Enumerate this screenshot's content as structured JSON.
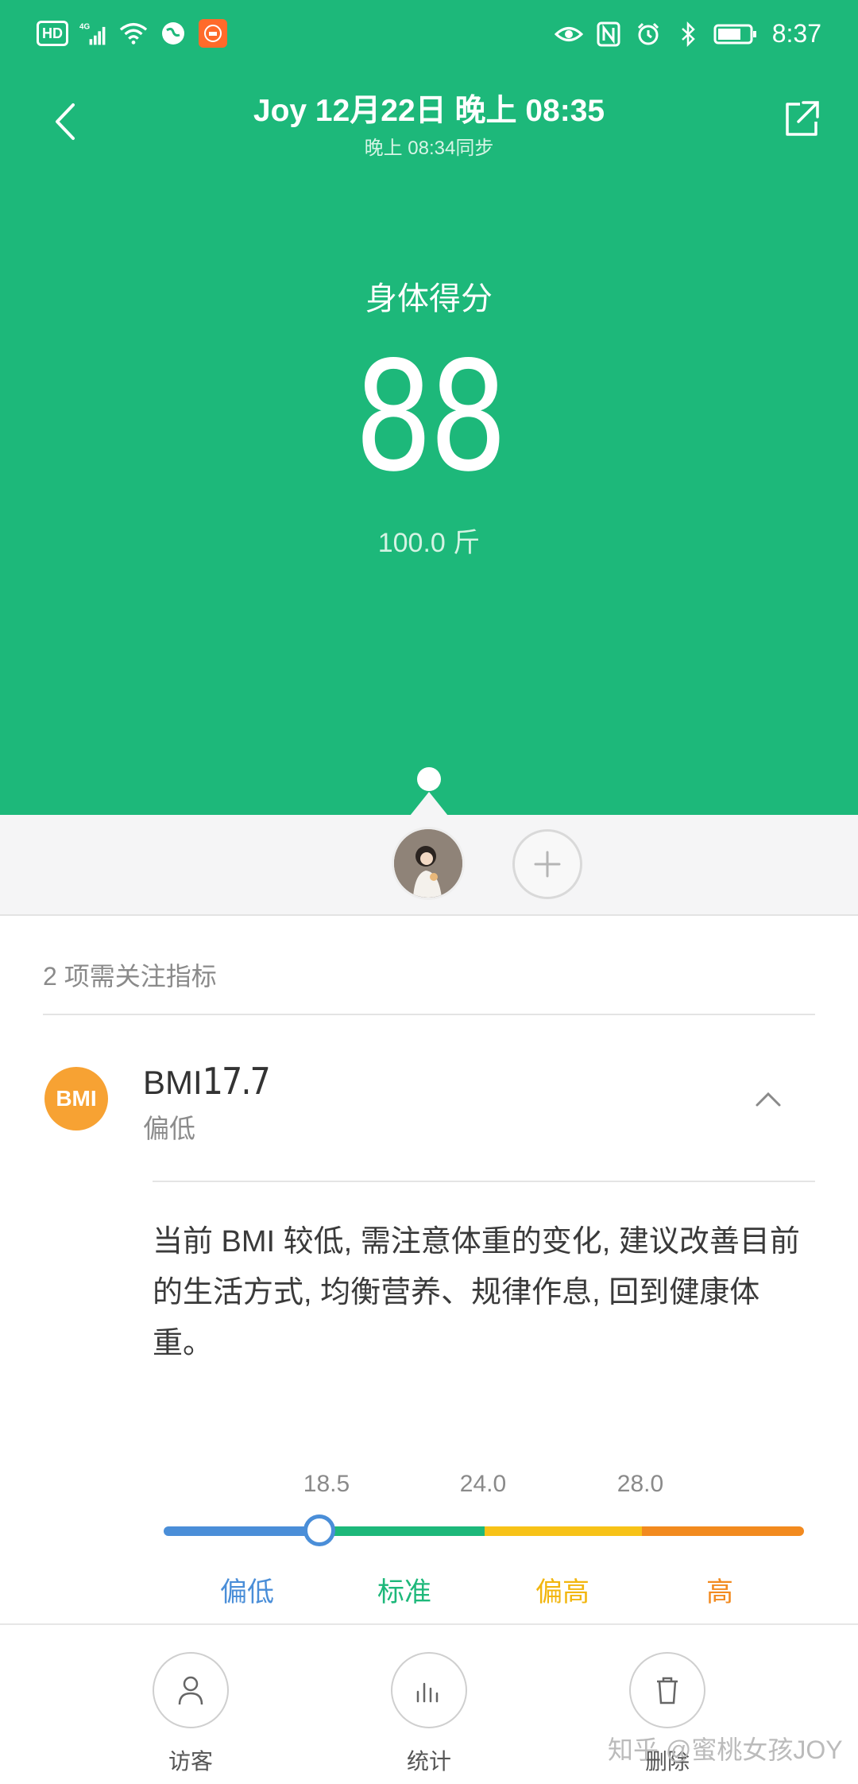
{
  "status_bar": {
    "hd_label": "HD",
    "signal_label": "4G",
    "time": "8:37",
    "icons": [
      "hd-icon",
      "signal-icon",
      "wifi-icon",
      "vpn-icon",
      "mi-app-icon",
      "eye-icon",
      "nfc-icon",
      "alarm-icon",
      "bluetooth-icon",
      "battery-icon"
    ]
  },
  "header": {
    "title": "Joy 12月22日 晚上 08:35",
    "subtitle": "晚上 08:34同步",
    "back_icon": "back-chevron-icon",
    "share_icon": "share-icon"
  },
  "score": {
    "label": "身体得分",
    "value": "88",
    "weight": "100.0 斤"
  },
  "users": {
    "add_icon": "plus-icon"
  },
  "indicators": {
    "header": "2 项需关注指标",
    "items": [
      {
        "badge": "BMI",
        "name": "BMI",
        "value": "17.7",
        "status": "偏低",
        "advice": "当前 BMI 较低, 需注意体重的变化, 建议改善目前的生活方式, 均衡营养、规律作息, 回到健康体重。"
      }
    ]
  },
  "bmi_scale": {
    "ticks": [
      "18.5",
      "24.0",
      "28.0"
    ],
    "categories": [
      "偏低",
      "标准",
      "偏高",
      "高"
    ],
    "current_value": 17.7,
    "colors": {
      "low": "#4a8ed8",
      "standard": "#1db87a",
      "high": "#f7c217",
      "obese": "#f28a1f"
    }
  },
  "bottom_nav": {
    "items": [
      {
        "label": "访客",
        "icon": "person-icon"
      },
      {
        "label": "统计",
        "icon": "bar-chart-icon"
      },
      {
        "label": "删除",
        "icon": "trash-icon"
      }
    ]
  },
  "watermark": "知乎 @蜜桃女孩JOY",
  "theme": {
    "primary": "#1db87a",
    "bmi_badge": "#f7a233"
  }
}
